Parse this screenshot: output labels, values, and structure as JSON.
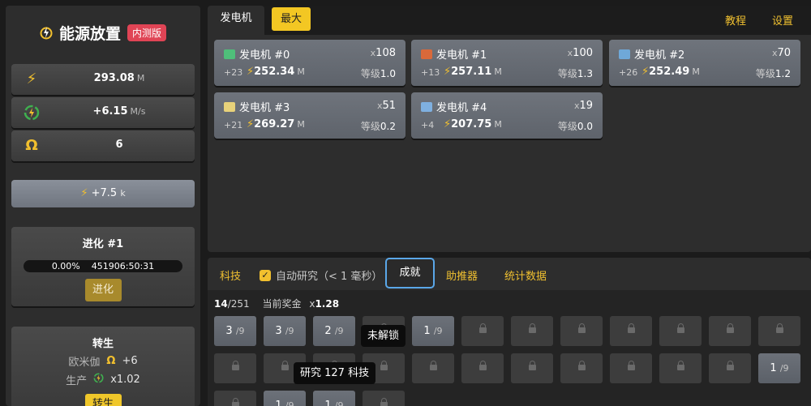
{
  "app": {
    "title": "能源放置",
    "badge": "内测版"
  },
  "stats": {
    "power": "293.08",
    "power_unit": "M",
    "rate": "+6.15",
    "rate_unit": "M/s",
    "omega": "6"
  },
  "boost": {
    "value": "+7.5",
    "unit": "k"
  },
  "evolve": {
    "title": "进化 #1",
    "percent": "0.00%",
    "time": "451906:50:31",
    "button": "进化"
  },
  "rebirth": {
    "title": "转生",
    "omega_label": "欧米伽",
    "omega_value": "+6",
    "prod_label": "生产",
    "prod_value": "x1.02",
    "button": "转生"
  },
  "top": {
    "tab": "发电机",
    "max_button": "最大",
    "tutorial": "教程",
    "settings": "设置"
  },
  "generators": [
    {
      "name": "发电机 #0",
      "count_prefix": "x",
      "count": "108",
      "inc": "+23",
      "power": "252.34",
      "unit": "M",
      "level_label": "等级",
      "level": "1.0",
      "icon_color": "#4fbf7a"
    },
    {
      "name": "发电机 #1",
      "count_prefix": "x",
      "count": "100",
      "inc": "+13",
      "power": "257.11",
      "unit": "M",
      "level_label": "等级",
      "level": "1.3",
      "icon_color": "#d9693a"
    },
    {
      "name": "发电机 #2",
      "count_prefix": "x",
      "count": "70",
      "inc": "+26",
      "power": "252.49",
      "unit": "M",
      "level_label": "等级",
      "level": "1.2",
      "icon_color": "#6fa8d8"
    },
    {
      "name": "发电机 #3",
      "count_prefix": "x",
      "count": "51",
      "inc": "+21",
      "power": "269.27",
      "unit": "M",
      "level_label": "等级",
      "level": "0.2",
      "icon_color": "#e8d27a"
    },
    {
      "name": "发电机 #4",
      "count_prefix": "x",
      "count": "19",
      "inc": "+4",
      "power": "207.75",
      "unit": "M",
      "level_label": "等级",
      "level": "0.0",
      "icon_color": "#7fb0e0"
    }
  ],
  "lower_tabs": {
    "research": "科技",
    "auto_research": "自动研究（< 1 毫秒）",
    "achievements": "成就",
    "boosters": "助推器",
    "statistics": "统计数据"
  },
  "achievements": {
    "count": "14",
    "total": "/251",
    "bonus_label": "当前奖金",
    "bonus_prefix": "x",
    "bonus": "1.28",
    "cells": [
      {
        "n": "3",
        "d": "/9"
      },
      {
        "n": "3",
        "d": "/9"
      },
      {
        "n": "2",
        "d": "/9"
      },
      {
        "n": "",
        "d": ""
      },
      {
        "n": "1",
        "d": "/9"
      },
      {
        "n": "",
        "d": ""
      },
      {
        "n": "",
        "d": ""
      },
      {
        "n": "",
        "d": ""
      },
      {
        "n": "",
        "d": ""
      },
      {
        "n": "",
        "d": ""
      },
      {
        "n": "",
        "d": ""
      },
      {
        "n": "",
        "d": ""
      },
      {
        "n": "",
        "d": ""
      },
      {
        "n": "",
        "d": ""
      },
      {
        "n": "",
        "d": ""
      },
      {
        "n": "",
        "d": ""
      },
      {
        "n": "",
        "d": ""
      },
      {
        "n": "",
        "d": ""
      },
      {
        "n": "",
        "d": ""
      },
      {
        "n": "",
        "d": ""
      },
      {
        "n": "",
        "d": ""
      },
      {
        "n": "",
        "d": ""
      },
      {
        "n": "",
        "d": ""
      },
      {
        "n": "1",
        "d": "/9"
      },
      {
        "n": "",
        "d": ""
      },
      {
        "n": "1",
        "d": "/9"
      },
      {
        "n": "1",
        "d": "/9"
      },
      {
        "n": "",
        "d": ""
      }
    ],
    "tooltip_locked": "未解锁",
    "tooltip_research": "研究 127 科技"
  }
}
